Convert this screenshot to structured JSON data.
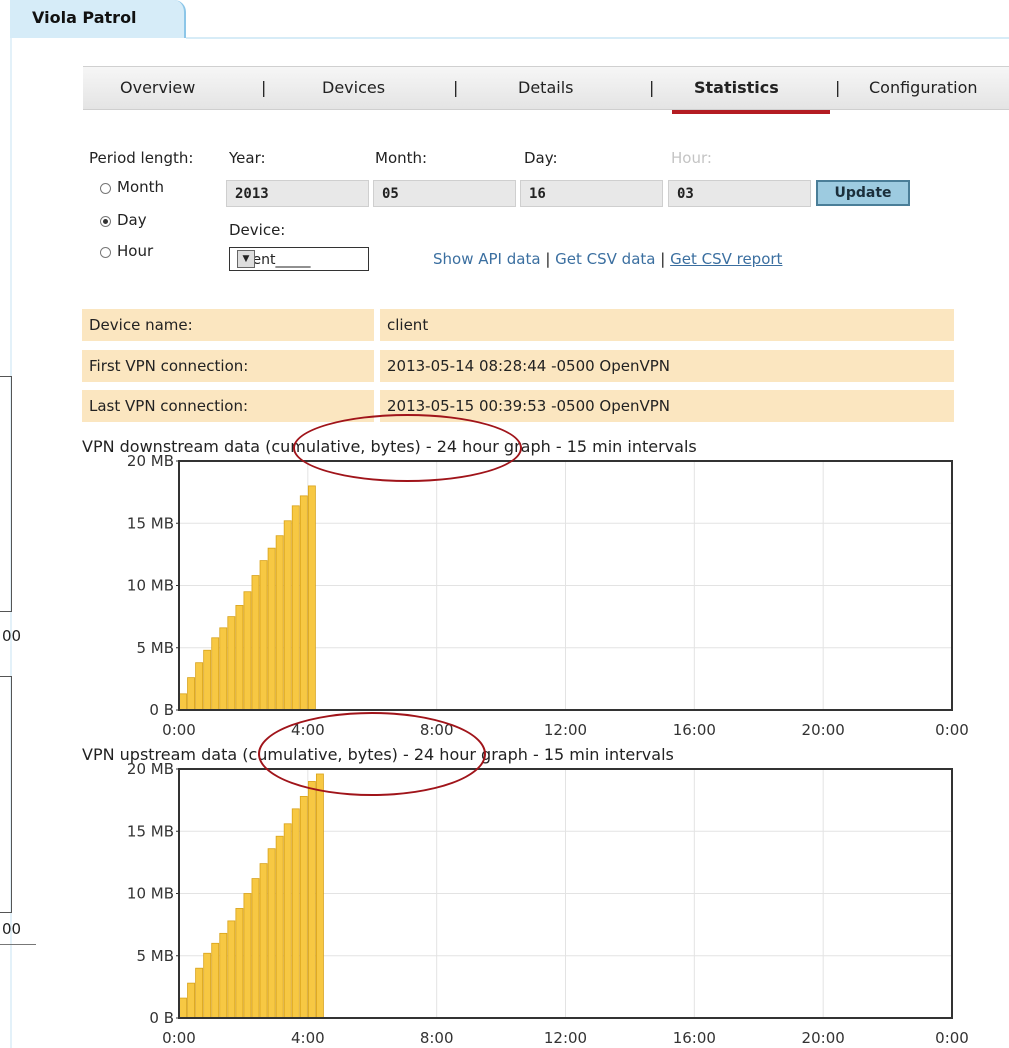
{
  "app": {
    "title": "Viola Patrol"
  },
  "nav": {
    "items": [
      {
        "label": "Overview",
        "active": false
      },
      {
        "label": "Devices",
        "active": false
      },
      {
        "label": "Details",
        "active": false
      },
      {
        "label": "Statistics",
        "active": true
      },
      {
        "label": "Configuration",
        "active": false
      }
    ],
    "separator": "|"
  },
  "period": {
    "label": "Period length:",
    "options": [
      "Month",
      "Day",
      "Hour"
    ],
    "selected": "Day",
    "year_label": "Year:",
    "month_label": "Month:",
    "day_label": "Day:",
    "hour_label": "Hour:",
    "year": "2013",
    "month": "05",
    "day": "16",
    "hour": "03",
    "update_label": "Update",
    "device_label": "Device:",
    "device_value": "client_____"
  },
  "links": {
    "api": "Show API data",
    "csv": "Get CSV data",
    "report": "Get CSV report",
    "sep": "|"
  },
  "info": {
    "device_name_label": "Device name:",
    "device_name": "client",
    "first_label": "First VPN connection:",
    "first_value": "2013-05-14 08:28:44 -0500 OpenVPN",
    "last_label": "Last VPN connection:",
    "last_value": "2013-05-15 00:39:53 -0500 OpenVPN"
  },
  "ghost": {
    "tick1": "00",
    "tick2": "00"
  },
  "chart_data": [
    {
      "type": "bar",
      "title": "VPN downstream data (cumulative, bytes) - 24 hour graph - 15 min intervals",
      "x_ticks": [
        "0:00",
        "4:00",
        "8:00",
        "12:00",
        "16:00",
        "20:00",
        "0:00"
      ],
      "y_ticks": [
        "0 B",
        "5 MB",
        "10 MB",
        "15 MB",
        "20 MB"
      ],
      "ylim": [
        0,
        20
      ],
      "xlim": [
        0,
        24
      ],
      "interval_hours": 0.25,
      "values": [
        1.3,
        2.6,
        3.8,
        4.8,
        5.8,
        6.6,
        7.5,
        8.4,
        9.5,
        10.8,
        12.0,
        13.0,
        14.0,
        15.2,
        16.4,
        17.2,
        18.0
      ],
      "bar_color": "#f7c843",
      "grid": true
    },
    {
      "type": "bar",
      "title": "VPN upstream data (cumulative, bytes) - 24 hour graph - 15 min intervals",
      "x_ticks": [
        "0:00",
        "4:00",
        "8:00",
        "12:00",
        "16:00",
        "20:00",
        "0:00"
      ],
      "y_ticks": [
        "0 B",
        "5 MB",
        "10 MB",
        "15 MB",
        "20 MB"
      ],
      "ylim": [
        0,
        20
      ],
      "xlim": [
        0,
        24
      ],
      "interval_hours": 0.25,
      "values": [
        1.6,
        2.8,
        4.0,
        5.2,
        6.0,
        6.8,
        7.8,
        8.8,
        10.0,
        11.2,
        12.4,
        13.6,
        14.6,
        15.6,
        16.8,
        17.8,
        19.0,
        19.6
      ],
      "bar_color": "#f7c843",
      "grid": true
    }
  ]
}
